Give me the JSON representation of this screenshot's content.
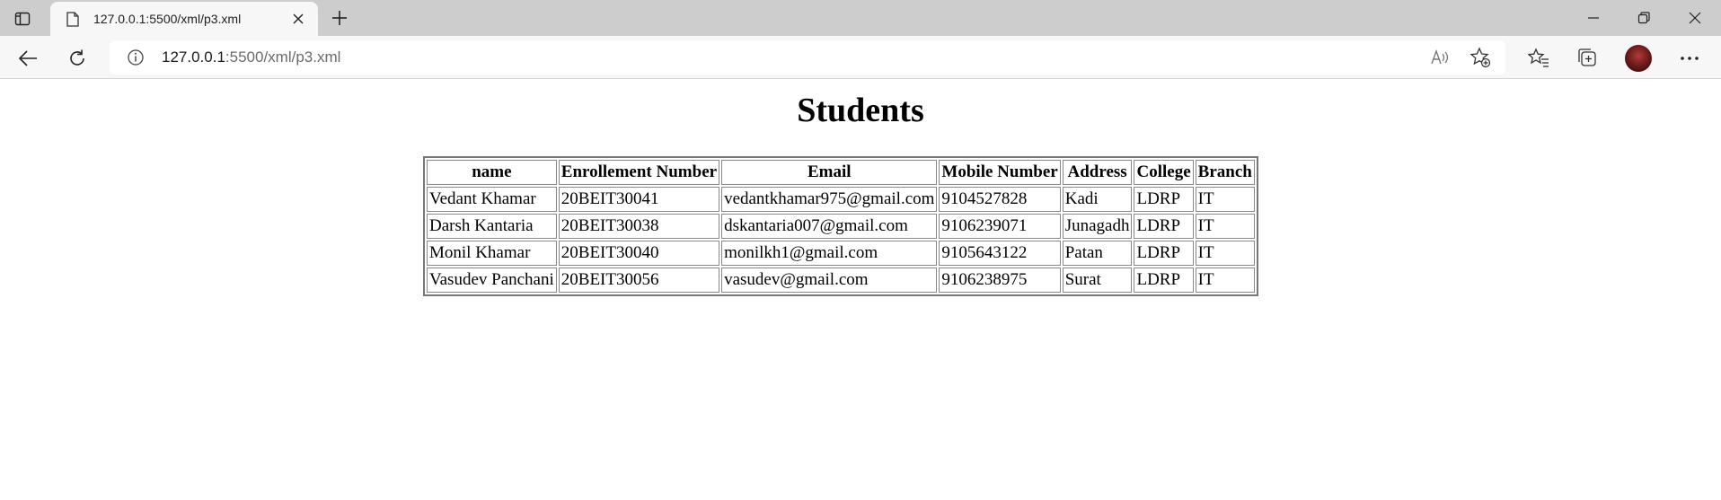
{
  "browser": {
    "tab": {
      "title": "127.0.0.1:5500/xml/p3.xml"
    },
    "address": {
      "host": "127.0.0.1",
      "path": ":5500/xml/p3.xml"
    }
  },
  "icons": {
    "tab_actions": "tab-actions-icon",
    "page": "page-icon",
    "close": "close-icon",
    "new_tab": "plus-icon",
    "back": "back-arrow-icon",
    "refresh": "refresh-icon",
    "info": "info-icon",
    "read_aloud": "read-aloud-icon",
    "favorite_add": "star-plus-icon",
    "favorites": "favorites-icon",
    "collections": "collections-icon",
    "more": "more-icon"
  },
  "page": {
    "heading": "Students"
  },
  "table": {
    "headers": [
      "name",
      "Enrollement Number",
      "Email",
      "Mobile Number",
      "Address",
      "College",
      "Branch"
    ],
    "rows": [
      [
        "Vedant Khamar",
        "20BEIT30041",
        "vedantkhamar975@gmail.com",
        "9104527828",
        "Kadi",
        "LDRP",
        "IT"
      ],
      [
        "Darsh Kantaria",
        "20BEIT30038",
        "dskantaria007@gmail.com",
        "9106239071",
        "Junagadh",
        "LDRP",
        "IT"
      ],
      [
        "Monil Khamar",
        "20BEIT30040",
        "monilkh1@gmail.com",
        "9105643122",
        "Patan",
        "LDRP",
        "IT"
      ],
      [
        "Vasudev Panchani",
        "20BEIT30056",
        "vasudev@gmail.com",
        "9106238975",
        "Surat",
        "LDRP",
        "IT"
      ]
    ]
  }
}
